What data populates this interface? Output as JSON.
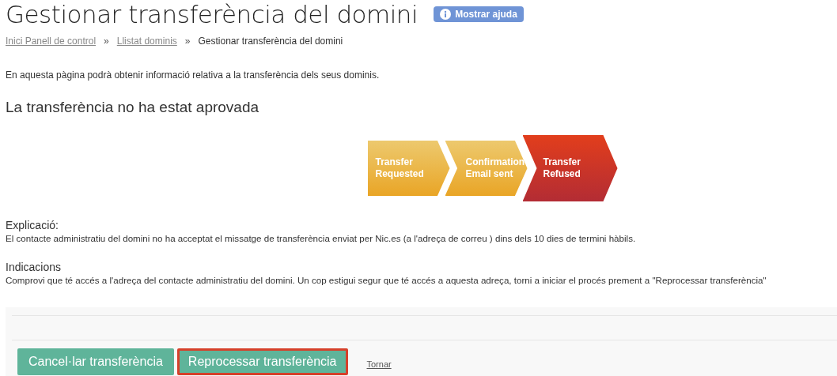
{
  "page": {
    "title": "Gestionar transferència del domini",
    "help_button": "Mostrar ajuda"
  },
  "breadcrumb": [
    {
      "label": "Inici Panell de control",
      "link": true
    },
    {
      "label": "Llistat dominis",
      "link": true
    },
    {
      "label": "Gestionar transferència del domini",
      "link": false
    }
  ],
  "breadcrumb_separator": "»",
  "intro": "En aquesta pàgina podrà obtenir informació relativa a la transferència dels seus dominis.",
  "status_heading": "La transferència no ha estat aprovada",
  "steps": [
    {
      "lines": [
        "Transfer",
        "Requested"
      ],
      "selected": false
    },
    {
      "lines": [
        "Confirmation",
        "Email sent"
      ],
      "selected": false
    },
    {
      "lines": [
        "Transfer",
        "Refused"
      ],
      "selected": true
    }
  ],
  "sections": [
    {
      "heading": "Explicació:",
      "text": "El contacte administratiu del domini no ha acceptat el missatge de transferència enviat per Nic.es (a l'adreça de correu ) dins dels 10 dies de termini hàbils."
    },
    {
      "heading": "Indicacions",
      "text": "Comprovi que té accés a l'adreça del contacte administratiu del domini. Un cop estigui segur que té accés a aquesta adreça, torni a iniciar el procés prement a \"Reprocessar transferència\""
    }
  ],
  "actions": [
    {
      "label": "Cancel·lar transferència",
      "focused": false
    },
    {
      "label": "Reprocessar transferència",
      "focused": true
    }
  ],
  "back_link": "Tornar"
}
